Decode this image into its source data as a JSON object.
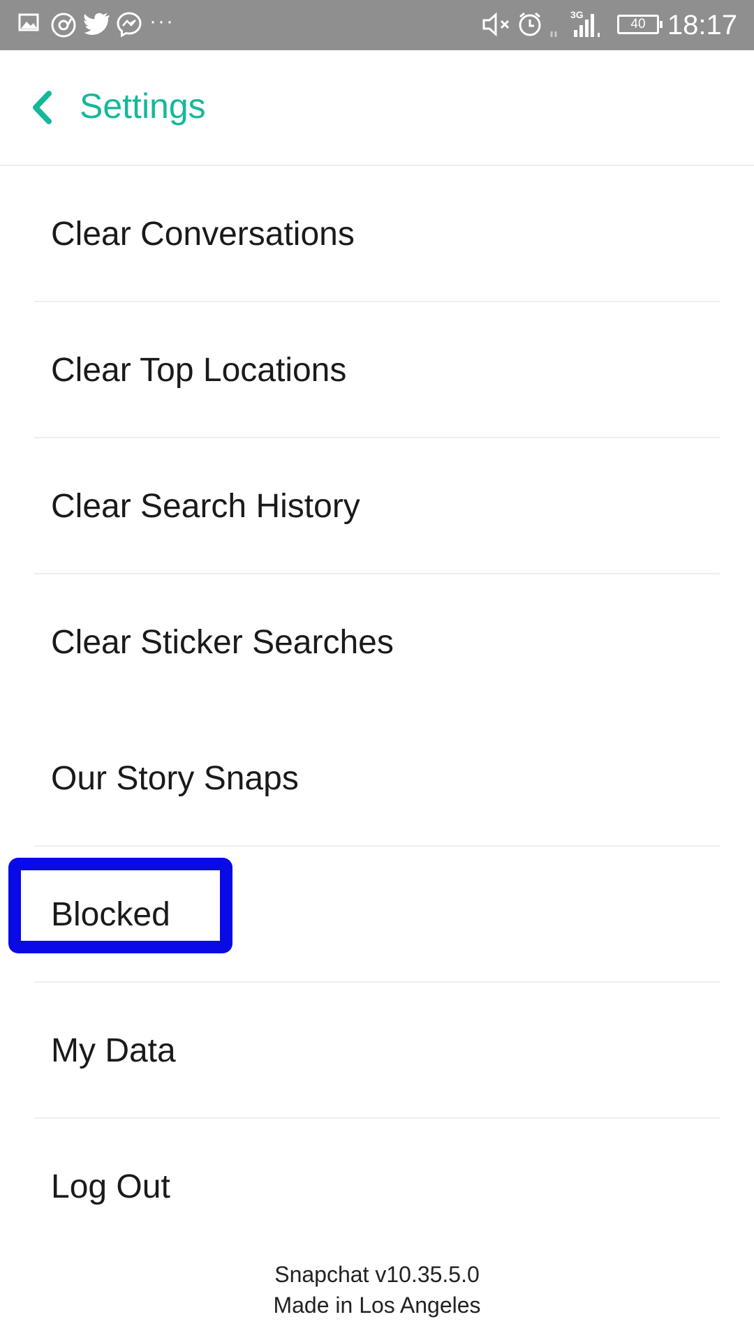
{
  "status_bar": {
    "time": "18:17",
    "battery": "40",
    "network": "3G",
    "icons": [
      "gallery-icon",
      "camera-sync-icon",
      "twitter-icon",
      "messenger-icon",
      "more-notifications-icon",
      "mute-icon",
      "alarm-icon",
      "signal-icon",
      "battery-icon"
    ],
    "more": "···"
  },
  "header": {
    "title": "Settings",
    "accent_color": "#16b89a"
  },
  "settings": {
    "items": [
      {
        "label": "Clear Conversations"
      },
      {
        "label": "Clear Top Locations"
      },
      {
        "label": "Clear Search History"
      },
      {
        "label": "Clear Sticker Searches"
      },
      {
        "label": "Our Story Snaps"
      },
      {
        "label": "Blocked"
      },
      {
        "label": "My Data"
      },
      {
        "label": "Log Out"
      }
    ]
  },
  "highlight": {
    "target": "Blocked",
    "color": "#0a0ae6"
  },
  "footer": {
    "version": "Snapchat v10.35.5.0",
    "made_in": "Made in Los Angeles"
  }
}
